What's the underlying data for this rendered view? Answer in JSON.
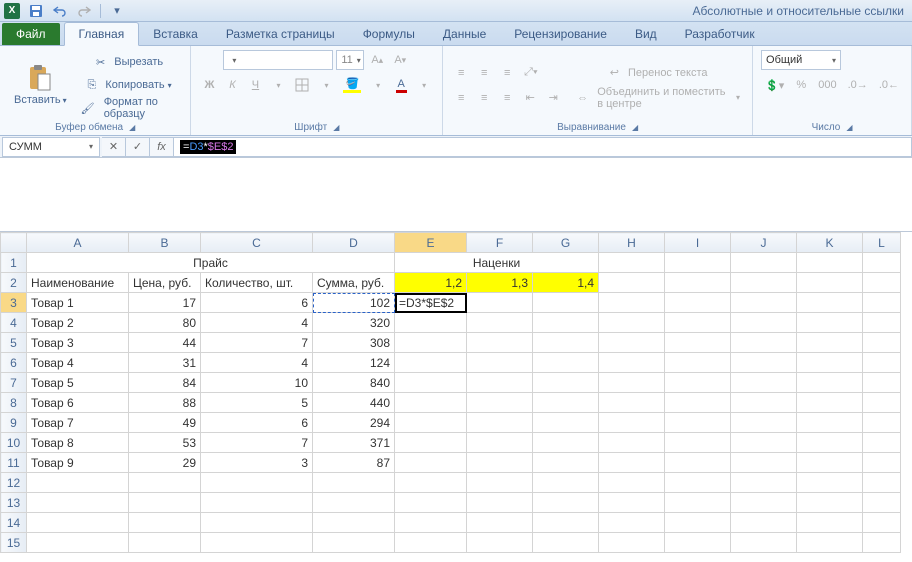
{
  "titlebar": {
    "app_initial": "X",
    "title": "Абсолютные и относительные ссылки"
  },
  "tabs": {
    "file": "Файл",
    "items": [
      "Главная",
      "Вставка",
      "Разметка страницы",
      "Формулы",
      "Данные",
      "Рецензирование",
      "Вид",
      "Разработчик"
    ],
    "active_index": 0
  },
  "ribbon": {
    "clipboard": {
      "paste": "Вставить",
      "cut": "Вырезать",
      "copy": "Копировать",
      "format_painter": "Формат по образцу",
      "label": "Буфер обмена"
    },
    "font": {
      "size": "11",
      "label": "Шрифт",
      "bold": "Ж",
      "italic": "К",
      "underline": "Ч"
    },
    "alignment": {
      "wrap": "Перенос текста",
      "merge": "Объединить и поместить в центре",
      "label": "Выравнивание"
    },
    "number": {
      "format": "Общий",
      "label": "Число"
    }
  },
  "fbar": {
    "name": "СУММ",
    "formula_eq": "=",
    "formula_ref1": "D3",
    "formula_op": "*",
    "formula_ref2": "$E$2"
  },
  "sheet": {
    "columns": [
      "A",
      "B",
      "C",
      "D",
      "E",
      "F",
      "G",
      "H",
      "I",
      "J",
      "K",
      "L"
    ],
    "active_col": "E",
    "active_row": 3,
    "editing_text": "=D3*$E$2",
    "row1": {
      "A_merge": "Прайс",
      "E_merge": "Наценки"
    },
    "headers": {
      "A": "Наименование",
      "B": "Цена, руб.",
      "C": "Количество, шт.",
      "D": "Сумма, руб.",
      "E": "1,2",
      "F": "1,3",
      "G": "1,4"
    },
    "rows": [
      {
        "n": 3,
        "A": "Товар 1",
        "B": "17",
        "C": "6",
        "D": "102"
      },
      {
        "n": 4,
        "A": "Товар 2",
        "B": "80",
        "C": "4",
        "D": "320"
      },
      {
        "n": 5,
        "A": "Товар 3",
        "B": "44",
        "C": "7",
        "D": "308"
      },
      {
        "n": 6,
        "A": "Товар 4",
        "B": "31",
        "C": "4",
        "D": "124"
      },
      {
        "n": 7,
        "A": "Товар 5",
        "B": "84",
        "C": "10",
        "D": "840"
      },
      {
        "n": 8,
        "A": "Товар 6",
        "B": "88",
        "C": "5",
        "D": "440"
      },
      {
        "n": 9,
        "A": "Товар 7",
        "B": "49",
        "C": "6",
        "D": "294"
      },
      {
        "n": 10,
        "A": "Товар 8",
        "B": "53",
        "C": "7",
        "D": "371"
      },
      {
        "n": 11,
        "A": "Товар 9",
        "B": "29",
        "C": "3",
        "D": "87"
      }
    ],
    "blank_rows": [
      12,
      13,
      14,
      15
    ]
  }
}
